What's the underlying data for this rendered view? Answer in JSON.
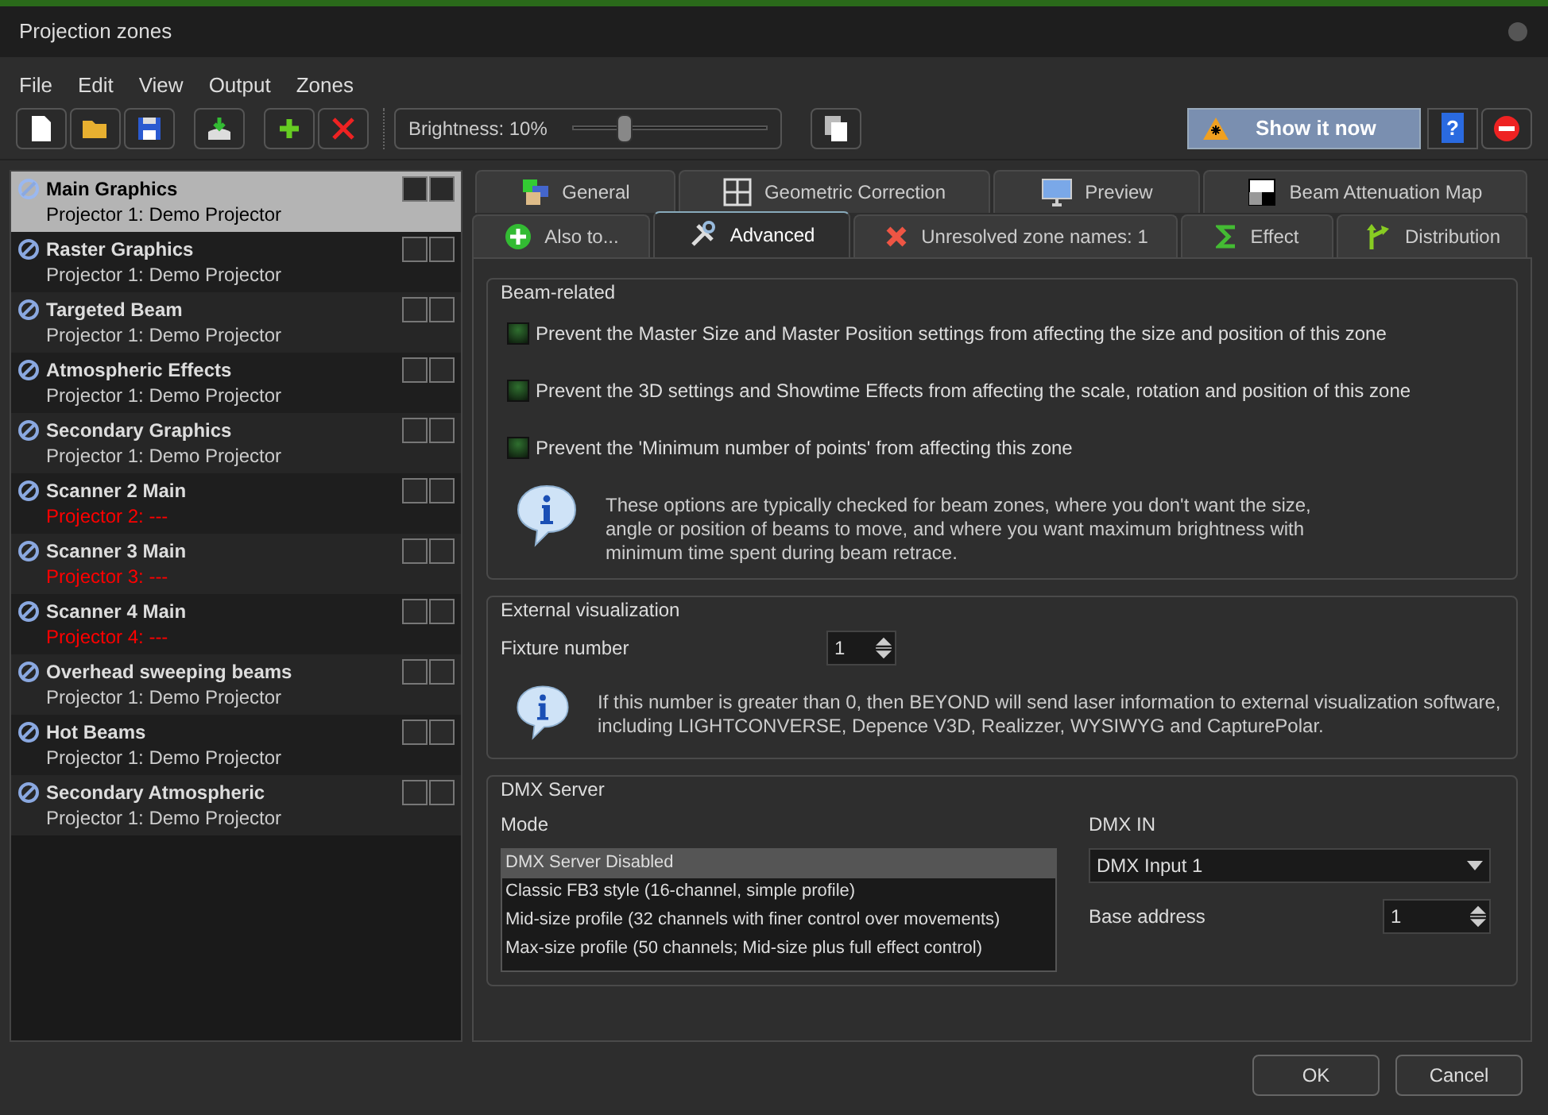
{
  "window": {
    "title": "Projection zones"
  },
  "menu": [
    "File",
    "Edit",
    "View",
    "Output",
    "Zones"
  ],
  "toolbar": {
    "brightness": {
      "label": "Brightness: 10%",
      "level": 0.27
    },
    "show_button": "Show it now",
    "help_button": "?"
  },
  "zones": [
    {
      "name": "Main Graphics",
      "projector": "Projector 1: Demo Projector",
      "warning": false,
      "selected": true
    },
    {
      "name": "Raster Graphics",
      "projector": "Projector 1: Demo Projector",
      "warning": false,
      "selected": false
    },
    {
      "name": "Targeted Beam",
      "projector": "Projector 1: Demo Projector",
      "warning": false,
      "selected": false
    },
    {
      "name": "Atmospheric Effects",
      "projector": "Projector 1: Demo Projector",
      "warning": false,
      "selected": false
    },
    {
      "name": "Secondary Graphics",
      "projector": "Projector 1: Demo Projector",
      "warning": false,
      "selected": false
    },
    {
      "name": "Scanner 2 Main",
      "projector": "Projector 2: ---",
      "warning": true,
      "selected": false
    },
    {
      "name": "Scanner 3 Main",
      "projector": "Projector 3: ---",
      "warning": true,
      "selected": false
    },
    {
      "name": "Scanner 4 Main",
      "projector": "Projector 4: ---",
      "warning": true,
      "selected": false
    },
    {
      "name": "Overhead sweeping beams",
      "projector": "Projector 1: Demo Projector",
      "warning": false,
      "selected": false
    },
    {
      "name": "Hot Beams",
      "projector": "Projector 1: Demo Projector",
      "warning": false,
      "selected": false
    },
    {
      "name": "Secondary Atmospheric",
      "projector": "Projector 1: Demo Projector",
      "warning": false,
      "selected": false
    }
  ],
  "tabs_row_1": [
    {
      "label": "General",
      "selected": false
    },
    {
      "label": "Geometric Correction",
      "selected": false
    },
    {
      "label": "Preview",
      "selected": false
    },
    {
      "label": "Beam Attenuation Map",
      "selected": false
    }
  ],
  "tabs_row_2": [
    {
      "label": "Also to...",
      "selected": false
    },
    {
      "label": "Advanced",
      "selected": true
    },
    {
      "label": "Unresolved zone names: 1",
      "selected": false
    },
    {
      "label": "Effect",
      "selected": false
    },
    {
      "label": "Distribution",
      "selected": false
    }
  ],
  "beam_related": {
    "title": "Beam-related",
    "options": [
      {
        "label": "Prevent the Master Size and Master Position settings from affecting the size and position of this zone",
        "checked": false
      },
      {
        "label": "Prevent the 3D settings and Showtime Effects from affecting the scale, rotation and position of this zone",
        "checked": false
      },
      {
        "label": "Prevent the 'Minimum number of points' from affecting this zone",
        "checked": false
      }
    ],
    "info": "These options are typically checked for beam zones, where you don't want the size, angle or position of beams to move, and where you want maximum brightness with minimum time spent during beam retrace."
  },
  "external_visualization": {
    "title": "External visualization",
    "fixture_label": "Fixture number",
    "fixture_value": "1",
    "info": "If this number is greater than 0, then BEYOND will send laser information to external visualization software, including LIGHTCONVERSE, Depence V3D, Realizzer, WYSIWYG and CapturePolar."
  },
  "dmx_server": {
    "title": "DMX Server",
    "mode_label": "Mode",
    "modes": [
      {
        "label": "DMX Server Disabled",
        "selected": true
      },
      {
        "label": "Classic FB3 style (16-channel, simple profile)",
        "selected": false
      },
      {
        "label": "Mid-size profile (32 channels with finer control over movements)",
        "selected": false
      },
      {
        "label": "Max-size profile (50 channels; Mid-size plus full effect control)",
        "selected": false
      }
    ],
    "dmx_in_label": "DMX IN",
    "dmx_in_value": "DMX Input 1",
    "base_address_label": "Base address",
    "base_address_value": "1"
  },
  "buttons": [
    "OK",
    "Cancel"
  ]
}
